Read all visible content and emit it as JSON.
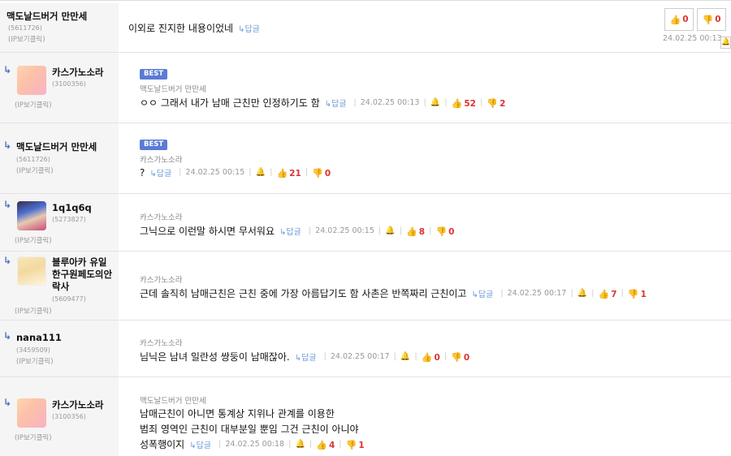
{
  "reply_label": "↳답글",
  "comments": [
    {
      "nick": "맥도날드버거 만만세",
      "uid": "(5611726)",
      "ip": "(IP보기클릭)",
      "text": "이외로 진지한 내용이었네",
      "date": "24.02.25 00:13",
      "up": "0",
      "down": "0"
    },
    {
      "nick": "카스가노소라",
      "uid": "(3100356)",
      "ip": "(IP보기클릭)",
      "best": "BEST",
      "tag": "맥도날드버거 만만세",
      "text": "ㅇㅇ 그래서 내가 남매 근친만 인정하기도 함",
      "date": "24.02.25 00:13",
      "up": "52",
      "down": "2"
    },
    {
      "nick": "맥도날드버거 만만세",
      "uid": "(5611726)",
      "ip": "(IP보기클릭)",
      "best": "BEST",
      "tag": "카스가노소라",
      "text": "?",
      "date": "24.02.25 00:15",
      "up": "21",
      "down": "0"
    },
    {
      "nick": "1q1q6q",
      "uid": "(5273827)",
      "ip": "(IP보기클릭)",
      "tag": "카스가노소라",
      "text": "그닉으로 이런말 하시면 무서워요",
      "date": "24.02.25 00:15",
      "up": "8",
      "down": "0"
    },
    {
      "nick_lines": [
        "블루아카 유일",
        "한구원페도의안",
        "락사"
      ],
      "uid": "(5609477)",
      "ip": "(IP보기클릭)",
      "tag": "카스가노소라",
      "text": "근데 솔직히 남매근친은 근친 중에 가장 아름답기도 함 사촌은 반쪽짜리 근친이고",
      "date": "24.02.25 00:17",
      "up": "7",
      "down": "1"
    },
    {
      "nick": "nana111",
      "uid": "(3459509)",
      "ip": "(IP보기클릭)",
      "tag": "카스가노소라",
      "text": "님닉은 남녀 일란성 쌍둥이 남매잖아.",
      "date": "24.02.25 00:17",
      "up": "0",
      "down": "0"
    },
    {
      "nick": "카스가노소라",
      "uid": "(3100356)",
      "ip": "(IP보기클릭)",
      "tag": "맥도날드버거 만만세",
      "text_lines": [
        "남매근친이 아니면 통계상 지위나 관계를 이용한",
        "범죄 영역인 근친이 대부분일 뿐임 그건 근친이 아니야",
        "성폭행이지"
      ],
      "date": "24.02.25 00:18",
      "up": "4",
      "down": "1"
    }
  ]
}
